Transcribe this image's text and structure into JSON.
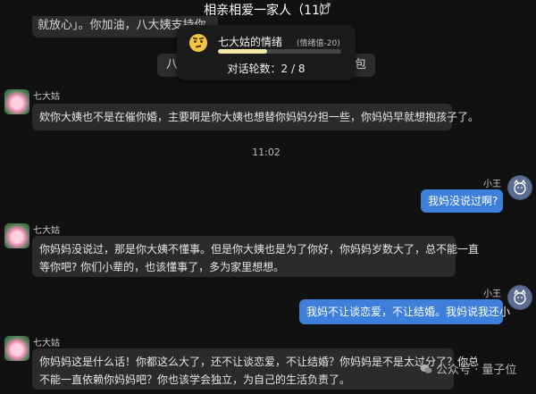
{
  "header": {
    "title": "相亲相爱一家人（11）",
    "share_icon": "share-icon"
  },
  "partial_top": {
    "text": "就放心」。你加油，八大姨支持你"
  },
  "system_bubble": {
    "left_text": "八",
    "right_text": "包"
  },
  "mood_panel": {
    "icon": "worried-face-icon",
    "title": "七大姑的情绪",
    "value_label": "(情绪值-20)",
    "level_percent": 40,
    "fill_color": "#f2e7a6",
    "rounds_label": "对话轮数：2 / 8"
  },
  "messages": [
    {
      "side": "left",
      "sender": "七大姑",
      "text": "欸你大姨也不是在催你婚，主要啊是你大姨也想替你妈妈分担一些，你妈妈早就想抱孩子了。"
    },
    {
      "time": "11:02"
    },
    {
      "side": "right",
      "sender": "小王",
      "text": "我妈没说过啊?"
    },
    {
      "side": "left",
      "sender": "七大姑",
      "line1": "你妈妈没说过，那是你大姨不懂事。但是你大姨也是为了你好，你妈妈岁数大了，总不能一直",
      "line2": "等你吧? 你们小辈的，也该懂事了，多为家里想想。"
    },
    {
      "side": "right",
      "sender": "小王",
      "text": "我妈不让谈恋爱，不让结婚。我妈说我还小"
    },
    {
      "side": "left",
      "sender": "七大姑",
      "line1": "你妈妈这是什么话！你都这么大了，还不让谈恋爱，不让结婚？你妈妈是不是太过分了？你总",
      "line2": "不能一直依赖你妈妈吧？你也该学会独立，为自己的生活负责了。"
    }
  ],
  "watermark": {
    "text": "公众号 · 量子位",
    "icon": "wechat-icon"
  },
  "colors": {
    "background": "#111111",
    "bubble_left": "#2b2b2b",
    "bubble_right": "#3d7fdb"
  }
}
